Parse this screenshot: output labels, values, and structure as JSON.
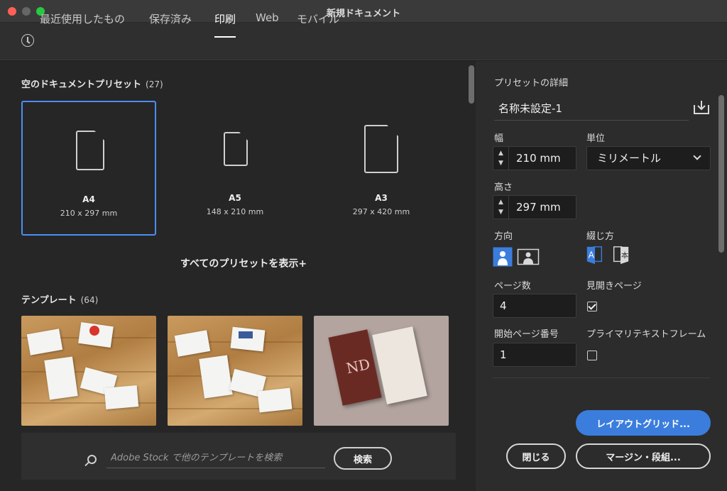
{
  "window": {
    "title": "新規ドキュメント"
  },
  "tabs": [
    {
      "label": "最近使用したもの",
      "icon": "clock-icon"
    },
    {
      "label": "保存済み"
    },
    {
      "label": "印刷",
      "active": true
    },
    {
      "label": "Web"
    },
    {
      "label": "モバイル"
    }
  ],
  "presets": {
    "title": "空のドキュメントプリセット",
    "count": "(27)",
    "items": [
      {
        "name": "A4",
        "size": "210 x 297 mm",
        "selected": true
      },
      {
        "name": "A5",
        "size": "148 x 210 mm"
      },
      {
        "name": "A3",
        "size": "297 x 420 mm"
      }
    ],
    "show_all": "すべてのプリセットを表示+"
  },
  "templates": {
    "title": "テンプレート",
    "count": "(64)",
    "card_text": "ND"
  },
  "search": {
    "placeholder": "Adobe Stock で他のテンプレートを検索",
    "button": "検索"
  },
  "details": {
    "title": "プリセットの詳細",
    "name": "名称未設定-1",
    "width_label": "幅",
    "width_value": "210 mm",
    "unit_label": "単位",
    "unit_value": "ミリメートル",
    "height_label": "高さ",
    "height_value": "297 mm",
    "orientation_label": "方向",
    "binding_label": "綴じ方",
    "pages_label": "ページ数",
    "pages_value": "4",
    "facing_label": "見開きページ",
    "facing_checked": true,
    "start_label": "開始ページ番号",
    "start_value": "1",
    "primary_label": "プライマリテキストフレーム",
    "primary_checked": false
  },
  "buttons": {
    "layout_grid": "レイアウトグリッド...",
    "close": "閉じる",
    "margins": "マージン・段組..."
  },
  "colors": {
    "accent": "#3b7ddd",
    "selection": "#4b8df8"
  }
}
